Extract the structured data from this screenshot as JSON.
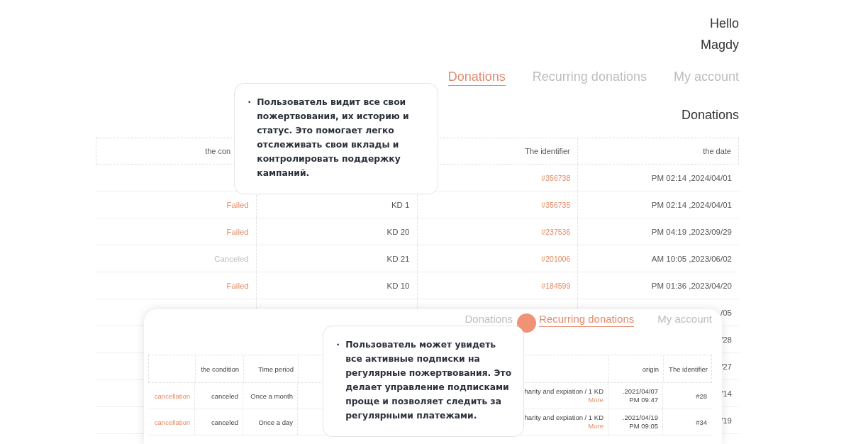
{
  "greeting": {
    "hello": "Hello",
    "user": "Magdy"
  },
  "tabs": [
    {
      "label": "Donations",
      "selected": true
    },
    {
      "label": "Recurring donations",
      "selected": false
    },
    {
      "label": "My account",
      "selected": false
    }
  ],
  "page_title": "Donations",
  "table": {
    "columns": [
      "the con",
      "The identifier",
      "the date"
    ],
    "rows": [
      {
        "identifier": "#356738",
        "date": "PM 02:14 ,2024/04/01"
      },
      {
        "condition": "Failed",
        "kind": "failed",
        "amount": "KD 1",
        "identifier": "#356735",
        "date": "PM 02:14 ,2024/04/01"
      },
      {
        "condition": "Failed",
        "kind": "failed",
        "amount": "KD 20",
        "identifier": "#237536",
        "date": "PM 04:19 ,2023/09/29"
      },
      {
        "condition": "Canceled",
        "kind": "canceled",
        "amount": "KD 21",
        "identifier": "#201006",
        "date": "AM 10:05 ,2023/06/02"
      },
      {
        "condition": "Failed",
        "kind": "failed",
        "amount": "KD 10",
        "identifier": "#184599",
        "date": "PM 01:36 ,2023/04/20"
      },
      {
        "date": "/05"
      },
      {
        "date": "/28"
      },
      {
        "date": "/27"
      },
      {
        "date": "/14"
      },
      {
        "date": "/19"
      }
    ]
  },
  "callouts": [
    {
      "bullet": "•",
      "text": "Пользователь видит все свои пожертвования, их историю и статус. Это помогает легко отслеживать свои вклады и контролировать поддержку кампаний."
    },
    {
      "bullet": "•",
      "text": "Пользователь может увидеть все активные подписки на регулярные пожертвования. Это делает управление подписками проще и позволяет следить за регулярными платежами."
    }
  ],
  "recurring_screen": {
    "tabs": [
      {
        "label": "Donations",
        "selected": false
      },
      {
        "label": "Recurring donations",
        "selected": true
      },
      {
        "label": "My account",
        "selected": false
      }
    ],
    "table": {
      "columns": [
        "the condition",
        "Time period",
        "origin",
        "The identifier"
      ],
      "rows": [
        {
          "action": "cancellation",
          "condition": "canceled",
          "period": "Once a month",
          "project": "harity and expiation / 1 KD",
          "link": "More",
          "origin_date": ".2021/04/07",
          "origin_time": "PM 09:47",
          "identifier": "#28"
        },
        {
          "action": "cancellation",
          "condition": "canceled",
          "period": "Once a day",
          "project": "harity and expiation / 1 KD",
          "link": "More",
          "origin_date": ".2021/04/19",
          "origin_time": "PM 09:05",
          "identifier": "#34"
        }
      ]
    }
  }
}
